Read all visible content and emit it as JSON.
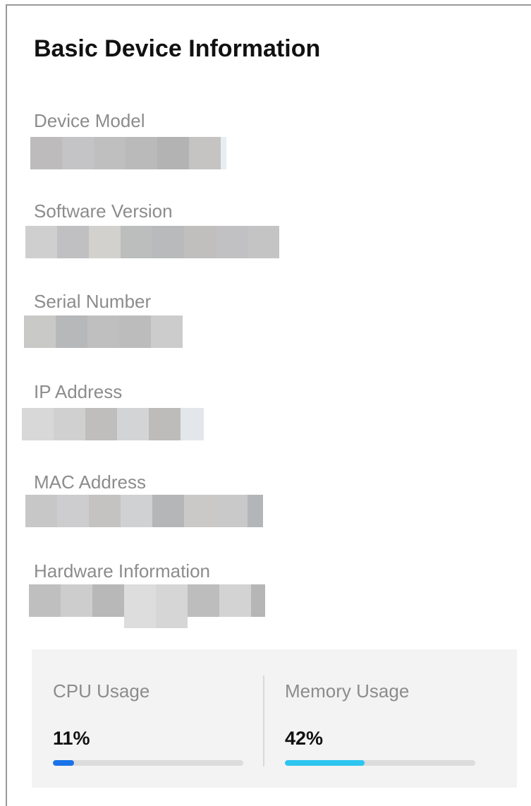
{
  "panel": {
    "title": "Basic Device Information",
    "fields": [
      {
        "label": "Device Model",
        "value_state": "redacted"
      },
      {
        "label": "Software Version",
        "value_state": "redacted"
      },
      {
        "label": "Serial Number",
        "value_state": "redacted"
      },
      {
        "label": "IP Address",
        "value_state": "redacted"
      },
      {
        "label": "MAC Address",
        "value_state": "redacted"
      },
      {
        "label": "Hardware Information",
        "value_state": "redacted"
      }
    ]
  },
  "stats": {
    "cpu": {
      "label": "CPU Usage",
      "value_text": "11%",
      "fraction": 0.11,
      "bar_color": "#1a73e8"
    },
    "memory": {
      "label": "Memory Usage",
      "value_text": "42%",
      "fraction": 0.42,
      "bar_color": "#2ec5f0"
    }
  },
  "colors": {
    "title": "#111111",
    "label": "#8c8c8c",
    "stats_background": "#f3f3f3",
    "track": "#dcdcdc",
    "border": "#999999"
  }
}
